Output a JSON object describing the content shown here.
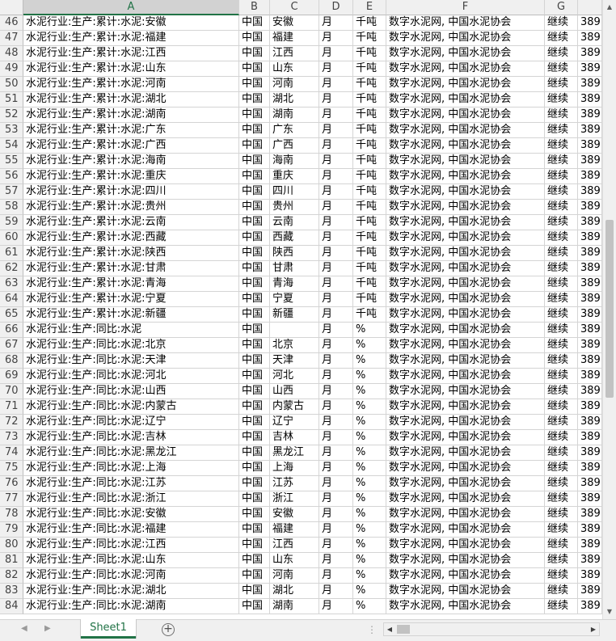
{
  "columns": [
    "A",
    "B",
    "C",
    "D",
    "E",
    "F",
    "G",
    ""
  ],
  "rows": [
    {
      "num": "46",
      "a": "水泥行业:生产:累计:水泥:安徽",
      "b": "中国",
      "c": "安徽",
      "d": "月",
      "e": "千吨",
      "f": "数字水泥网, 中国水泥协会",
      "g": "继续",
      "h": "389"
    },
    {
      "num": "47",
      "a": "水泥行业:生产:累计:水泥:福建",
      "b": "中国",
      "c": "福建",
      "d": "月",
      "e": "千吨",
      "f": "数字水泥网, 中国水泥协会",
      "g": "继续",
      "h": "389"
    },
    {
      "num": "48",
      "a": "水泥行业:生产:累计:水泥:江西",
      "b": "中国",
      "c": "江西",
      "d": "月",
      "e": "千吨",
      "f": "数字水泥网, 中国水泥协会",
      "g": "继续",
      "h": "389"
    },
    {
      "num": "49",
      "a": "水泥行业:生产:累计:水泥:山东",
      "b": "中国",
      "c": "山东",
      "d": "月",
      "e": "千吨",
      "f": "数字水泥网, 中国水泥协会",
      "g": "继续",
      "h": "389"
    },
    {
      "num": "50",
      "a": "水泥行业:生产:累计:水泥:河南",
      "b": "中国",
      "c": "河南",
      "d": "月",
      "e": "千吨",
      "f": "数字水泥网, 中国水泥协会",
      "g": "继续",
      "h": "389"
    },
    {
      "num": "51",
      "a": "水泥行业:生产:累计:水泥:湖北",
      "b": "中国",
      "c": "湖北",
      "d": "月",
      "e": "千吨",
      "f": "数字水泥网, 中国水泥协会",
      "g": "继续",
      "h": "389"
    },
    {
      "num": "52",
      "a": "水泥行业:生产:累计:水泥:湖南",
      "b": "中国",
      "c": "湖南",
      "d": "月",
      "e": "千吨",
      "f": "数字水泥网, 中国水泥协会",
      "g": "继续",
      "h": "389"
    },
    {
      "num": "53",
      "a": "水泥行业:生产:累计:水泥:广东",
      "b": "中国",
      "c": "广东",
      "d": "月",
      "e": "千吨",
      "f": "数字水泥网, 中国水泥协会",
      "g": "继续",
      "h": "389"
    },
    {
      "num": "54",
      "a": "水泥行业:生产:累计:水泥:广西",
      "b": "中国",
      "c": "广西",
      "d": "月",
      "e": "千吨",
      "f": "数字水泥网, 中国水泥协会",
      "g": "继续",
      "h": "389"
    },
    {
      "num": "55",
      "a": "水泥行业:生产:累计:水泥:海南",
      "b": "中国",
      "c": "海南",
      "d": "月",
      "e": "千吨",
      "f": "数字水泥网, 中国水泥协会",
      "g": "继续",
      "h": "389"
    },
    {
      "num": "56",
      "a": "水泥行业:生产:累计:水泥:重庆",
      "b": "中国",
      "c": "重庆",
      "d": "月",
      "e": "千吨",
      "f": "数字水泥网, 中国水泥协会",
      "g": "继续",
      "h": "389"
    },
    {
      "num": "57",
      "a": "水泥行业:生产:累计:水泥:四川",
      "b": "中国",
      "c": "四川",
      "d": "月",
      "e": "千吨",
      "f": "数字水泥网, 中国水泥协会",
      "g": "继续",
      "h": "389"
    },
    {
      "num": "58",
      "a": "水泥行业:生产:累计:水泥:贵州",
      "b": "中国",
      "c": "贵州",
      "d": "月",
      "e": "千吨",
      "f": "数字水泥网, 中国水泥协会",
      "g": "继续",
      "h": "389"
    },
    {
      "num": "59",
      "a": "水泥行业:生产:累计:水泥:云南",
      "b": "中国",
      "c": "云南",
      "d": "月",
      "e": "千吨",
      "f": "数字水泥网, 中国水泥协会",
      "g": "继续",
      "h": "389"
    },
    {
      "num": "60",
      "a": "水泥行业:生产:累计:水泥:西藏",
      "b": "中国",
      "c": "西藏",
      "d": "月",
      "e": "千吨",
      "f": "数字水泥网, 中国水泥协会",
      "g": "继续",
      "h": "389"
    },
    {
      "num": "61",
      "a": "水泥行业:生产:累计:水泥:陕西",
      "b": "中国",
      "c": "陕西",
      "d": "月",
      "e": "千吨",
      "f": "数字水泥网, 中国水泥协会",
      "g": "继续",
      "h": "389"
    },
    {
      "num": "62",
      "a": "水泥行业:生产:累计:水泥:甘肃",
      "b": "中国",
      "c": "甘肃",
      "d": "月",
      "e": "千吨",
      "f": "数字水泥网, 中国水泥协会",
      "g": "继续",
      "h": "389"
    },
    {
      "num": "63",
      "a": "水泥行业:生产:累计:水泥:青海",
      "b": "中国",
      "c": "青海",
      "d": "月",
      "e": "千吨",
      "f": "数字水泥网, 中国水泥协会",
      "g": "继续",
      "h": "389"
    },
    {
      "num": "64",
      "a": "水泥行业:生产:累计:水泥:宁夏",
      "b": "中国",
      "c": "宁夏",
      "d": "月",
      "e": "千吨",
      "f": "数字水泥网, 中国水泥协会",
      "g": "继续",
      "h": "389"
    },
    {
      "num": "65",
      "a": "水泥行业:生产:累计:水泥:新疆",
      "b": "中国",
      "c": "新疆",
      "d": "月",
      "e": "千吨",
      "f": "数字水泥网, 中国水泥协会",
      "g": "继续",
      "h": "389"
    },
    {
      "num": "66",
      "a": "水泥行业:生产:同比:水泥",
      "b": "中国",
      "c": "",
      "d": "月",
      "e": "%",
      "f": "数字水泥网, 中国水泥协会",
      "g": "继续",
      "h": "389"
    },
    {
      "num": "67",
      "a": "水泥行业:生产:同比:水泥:北京",
      "b": "中国",
      "c": "北京",
      "d": "月",
      "e": "%",
      "f": "数字水泥网, 中国水泥协会",
      "g": "继续",
      "h": "389"
    },
    {
      "num": "68",
      "a": "水泥行业:生产:同比:水泥:天津",
      "b": "中国",
      "c": "天津",
      "d": "月",
      "e": "%",
      "f": "数字水泥网, 中国水泥协会",
      "g": "继续",
      "h": "389"
    },
    {
      "num": "69",
      "a": "水泥行业:生产:同比:水泥:河北",
      "b": "中国",
      "c": "河北",
      "d": "月",
      "e": "%",
      "f": "数字水泥网, 中国水泥协会",
      "g": "继续",
      "h": "389"
    },
    {
      "num": "70",
      "a": "水泥行业:生产:同比:水泥:山西",
      "b": "中国",
      "c": "山西",
      "d": "月",
      "e": "%",
      "f": "数字水泥网, 中国水泥协会",
      "g": "继续",
      "h": "389"
    },
    {
      "num": "71",
      "a": "水泥行业:生产:同比:水泥:内蒙古",
      "b": "中国",
      "c": "内蒙古",
      "d": "月",
      "e": "%",
      "f": "数字水泥网, 中国水泥协会",
      "g": "继续",
      "h": "389"
    },
    {
      "num": "72",
      "a": "水泥行业:生产:同比:水泥:辽宁",
      "b": "中国",
      "c": "辽宁",
      "d": "月",
      "e": "%",
      "f": "数字水泥网, 中国水泥协会",
      "g": "继续",
      "h": "389"
    },
    {
      "num": "73",
      "a": "水泥行业:生产:同比:水泥:吉林",
      "b": "中国",
      "c": "吉林",
      "d": "月",
      "e": "%",
      "f": "数字水泥网, 中国水泥协会",
      "g": "继续",
      "h": "389"
    },
    {
      "num": "74",
      "a": "水泥行业:生产:同比:水泥:黑龙江",
      "b": "中国",
      "c": "黑龙江",
      "d": "月",
      "e": "%",
      "f": "数字水泥网, 中国水泥协会",
      "g": "继续",
      "h": "389"
    },
    {
      "num": "75",
      "a": "水泥行业:生产:同比:水泥:上海",
      "b": "中国",
      "c": "上海",
      "d": "月",
      "e": "%",
      "f": "数字水泥网, 中国水泥协会",
      "g": "继续",
      "h": "389"
    },
    {
      "num": "76",
      "a": "水泥行业:生产:同比:水泥:江苏",
      "b": "中国",
      "c": "江苏",
      "d": "月",
      "e": "%",
      "f": "数字水泥网, 中国水泥协会",
      "g": "继续",
      "h": "389"
    },
    {
      "num": "77",
      "a": "水泥行业:生产:同比:水泥:浙江",
      "b": "中国",
      "c": "浙江",
      "d": "月",
      "e": "%",
      "f": "数字水泥网, 中国水泥协会",
      "g": "继续",
      "h": "389"
    },
    {
      "num": "78",
      "a": "水泥行业:生产:同比:水泥:安徽",
      "b": "中国",
      "c": "安徽",
      "d": "月",
      "e": "%",
      "f": "数字水泥网, 中国水泥协会",
      "g": "继续",
      "h": "389"
    },
    {
      "num": "79",
      "a": "水泥行业:生产:同比:水泥:福建",
      "b": "中国",
      "c": "福建",
      "d": "月",
      "e": "%",
      "f": "数字水泥网, 中国水泥协会",
      "g": "继续",
      "h": "389"
    },
    {
      "num": "80",
      "a": "水泥行业:生产:同比:水泥:江西",
      "b": "中国",
      "c": "江西",
      "d": "月",
      "e": "%",
      "f": "数字水泥网, 中国水泥协会",
      "g": "继续",
      "h": "389"
    },
    {
      "num": "81",
      "a": "水泥行业:生产:同比:水泥:山东",
      "b": "中国",
      "c": "山东",
      "d": "月",
      "e": "%",
      "f": "数字水泥网, 中国水泥协会",
      "g": "继续",
      "h": "389"
    },
    {
      "num": "82",
      "a": "水泥行业:生产:同比:水泥:河南",
      "b": "中国",
      "c": "河南",
      "d": "月",
      "e": "%",
      "f": "数字水泥网, 中国水泥协会",
      "g": "继续",
      "h": "389"
    },
    {
      "num": "83",
      "a": "水泥行业:生产:同比:水泥:湖北",
      "b": "中国",
      "c": "湖北",
      "d": "月",
      "e": "%",
      "f": "数字水泥网, 中国水泥协会",
      "g": "继续",
      "h": "389"
    },
    {
      "num": "84",
      "a": "水泥行业:生产:同比:水泥:湖南",
      "b": "中国",
      "c": "湖南",
      "d": "月",
      "e": "%",
      "f": "数字水泥网, 中国水泥协会",
      "g": "继续",
      "h": "389"
    }
  ],
  "sheet_tabs": [
    "Sheet1"
  ],
  "add_sheet_label": "+",
  "tab_options_label": "⋮",
  "icons": {
    "scroll_up": "up-arrow-icon",
    "scroll_down": "down-arrow-icon",
    "scroll_left": "left-arrow-icon",
    "scroll_right": "right-arrow-icon",
    "add_sheet": "plus-circle-icon"
  },
  "colors": {
    "accent": "#217346",
    "header_bg": "#f0f0f0",
    "selected_header_bg": "#d2d2d2",
    "gridline": "#d4d4d4"
  }
}
